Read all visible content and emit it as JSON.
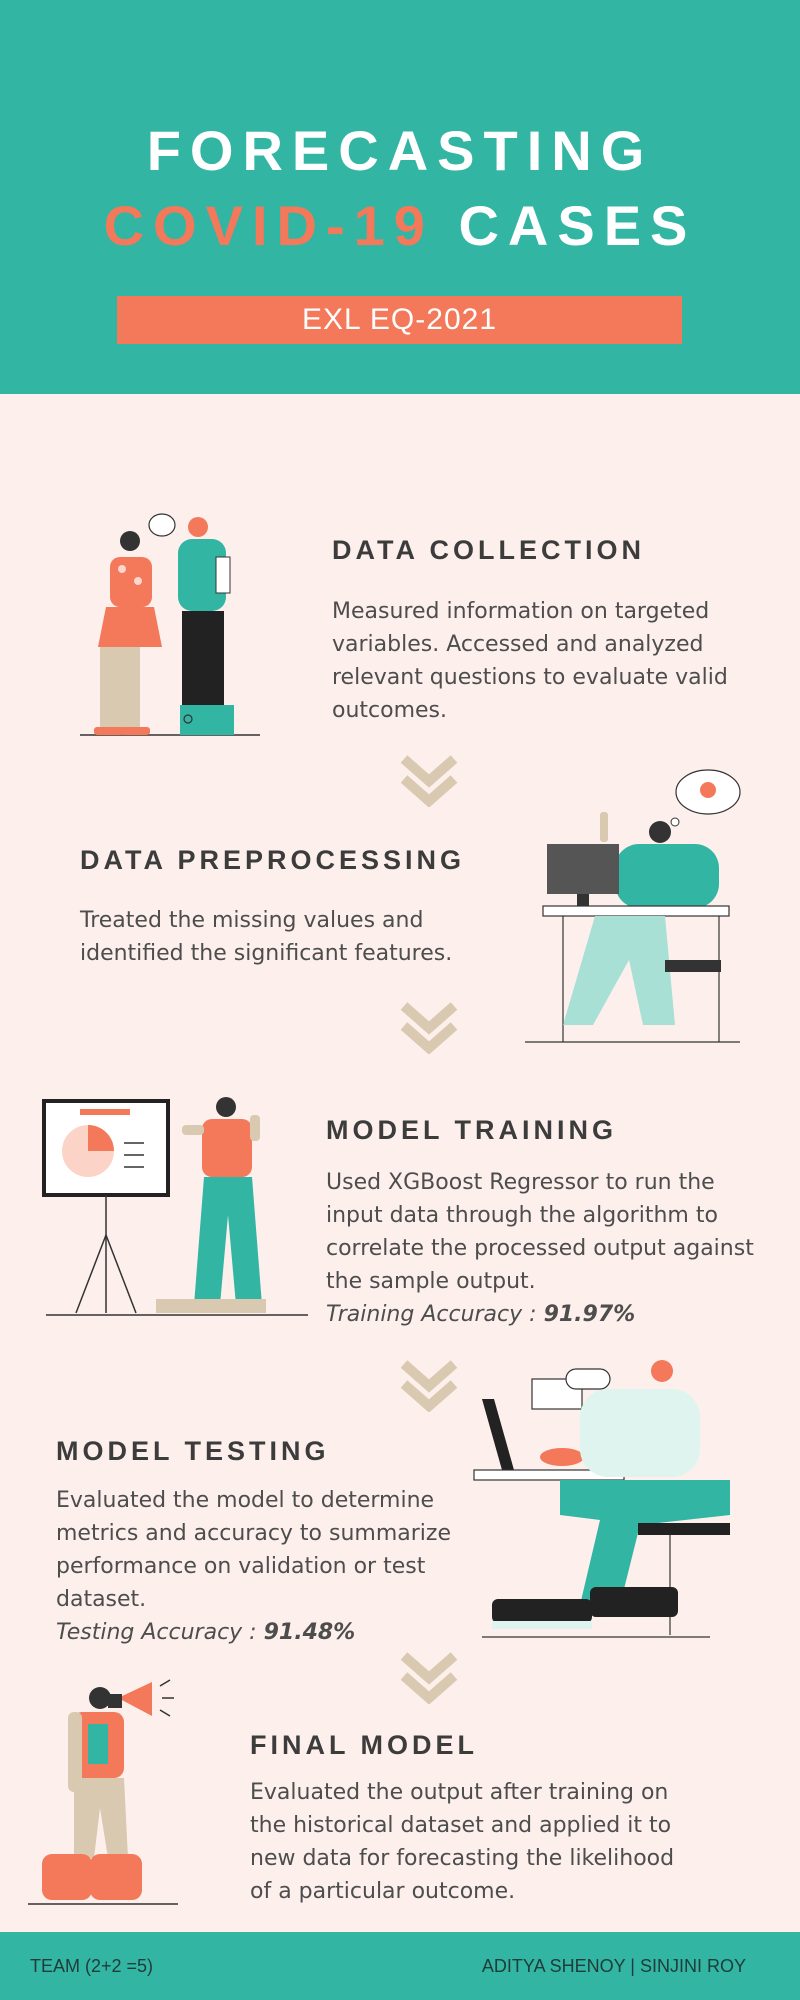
{
  "header": {
    "title_line1": "FORECASTING",
    "title_accent": "COVID-19",
    "title_rest": "CASES",
    "subtitle": "EXL EQ-2021"
  },
  "colors": {
    "teal": "#33b5a3",
    "coral": "#f4785a",
    "background": "#fdf0ec",
    "chevron": "#d8c9b0",
    "text": "#4d4d4d"
  },
  "steps": [
    {
      "title": "DATA COLLECTION",
      "body": "Measured information on targeted variables. Accessed and analyzed relevant questions to evaluate valid outcomes.",
      "illustration": "two-people-with-tablet"
    },
    {
      "title": "DATA PREPROCESSING",
      "body": "Treated the missing values and identified the significant features.",
      "illustration": "person-at-desk-with-idea"
    },
    {
      "title": "MODEL TRAINING",
      "body": "Used XGBoost Regressor to run the input data through the algorithm to correlate the processed output against the sample output.",
      "accuracy_label": "Training Accuracy : ",
      "accuracy_value": "91.97%",
      "illustration": "presenter-with-pie-chart-board"
    },
    {
      "title": "MODEL TESTING",
      "body": "Evaluated the model to determine metrics and accuracy to summarize performance on validation or test dataset.",
      "accuracy_label": "Testing Accuracy : ",
      "accuracy_value": "91.48%",
      "illustration": "person-with-laptop"
    },
    {
      "title": "FINAL MODEL",
      "body": "Evaluated the output after training on the historical dataset and applied it to new data for forecasting the likelihood of a particular outcome.",
      "illustration": "person-with-megaphone"
    }
  ],
  "icons": {
    "flow_arrow": "double-chevron-down-icon"
  },
  "footer": {
    "team": "TEAM (2+2 =5)",
    "authors": "ADITYA SHENOY | SINJINI ROY"
  }
}
